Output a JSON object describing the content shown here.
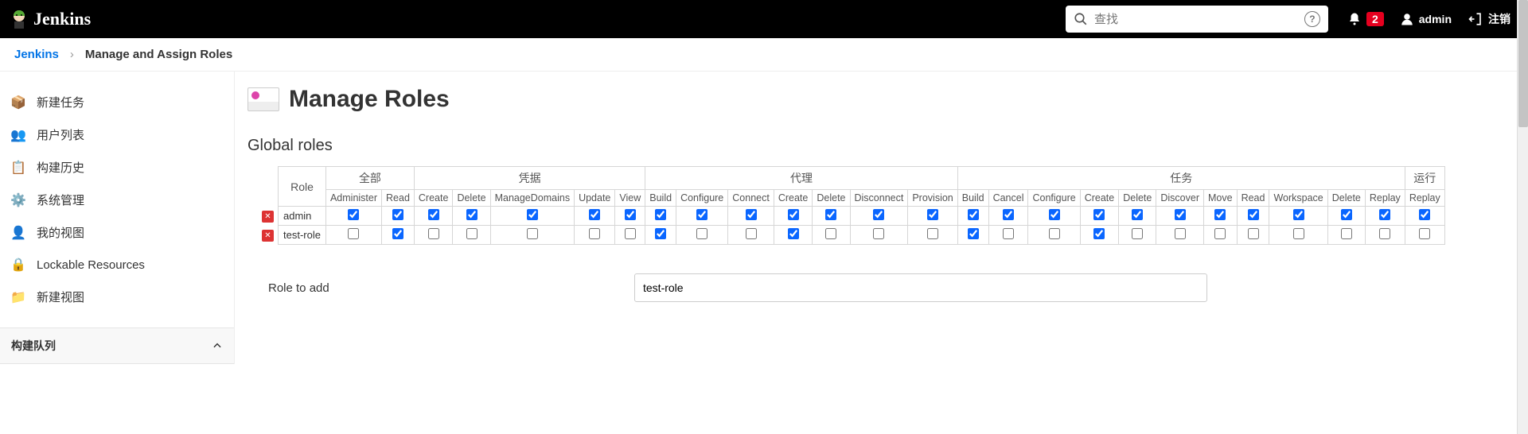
{
  "header": {
    "brand": "Jenkins",
    "search_placeholder": "查找",
    "notif_count": "2",
    "username": "admin",
    "logout": "注销"
  },
  "breadcrumb": {
    "root": "Jenkins",
    "current": "Manage and Assign Roles"
  },
  "sidebar": {
    "items": [
      {
        "icon": "new-job-icon",
        "label": "新建任务",
        "emoji": "📦"
      },
      {
        "icon": "users-icon",
        "label": "用户列表",
        "emoji": "👥"
      },
      {
        "icon": "history-icon",
        "label": "构建历史",
        "emoji": "📋"
      },
      {
        "icon": "manage-icon",
        "label": "系统管理",
        "emoji": "⚙️"
      },
      {
        "icon": "my-views-icon",
        "label": "我的视图",
        "emoji": "👤"
      },
      {
        "icon": "lockable-icon",
        "label": "Lockable Resources",
        "emoji": "🔒"
      },
      {
        "icon": "new-view-icon",
        "label": "新建视图",
        "emoji": "📁"
      }
    ],
    "queue_label": "构建队列"
  },
  "page": {
    "title": "Manage Roles",
    "section": "Global roles"
  },
  "table": {
    "role_header": "Role",
    "groups": [
      {
        "label": "全部",
        "span": 2
      },
      {
        "label": "凭据",
        "span": 5
      },
      {
        "label": "代理",
        "span": 7
      },
      {
        "label": "任务",
        "span": 11
      },
      {
        "label": "运行",
        "span": 1
      }
    ],
    "perms": [
      "Administer",
      "Read",
      "Create",
      "Delete",
      "ManageDomains",
      "Update",
      "View",
      "Build",
      "Configure",
      "Connect",
      "Create",
      "Delete",
      "Disconnect",
      "Provision",
      "Build",
      "Cancel",
      "Configure",
      "Create",
      "Delete",
      "Discover",
      "Move",
      "Read",
      "Workspace",
      "Delete",
      "Replay",
      "Replay"
    ],
    "rows": [
      {
        "name": "admin",
        "checks": [
          true,
          true,
          true,
          true,
          true,
          true,
          true,
          true,
          true,
          true,
          true,
          true,
          true,
          true,
          true,
          true,
          true,
          true,
          true,
          true,
          true,
          true,
          true,
          true,
          true,
          true
        ]
      },
      {
        "name": "test-role",
        "checks": [
          false,
          true,
          false,
          false,
          false,
          false,
          false,
          true,
          false,
          false,
          true,
          false,
          false,
          false,
          true,
          false,
          false,
          true,
          false,
          false,
          false,
          false,
          false,
          false,
          false,
          false
        ]
      }
    ]
  },
  "add": {
    "label": "Role to add",
    "value": "test-role"
  }
}
